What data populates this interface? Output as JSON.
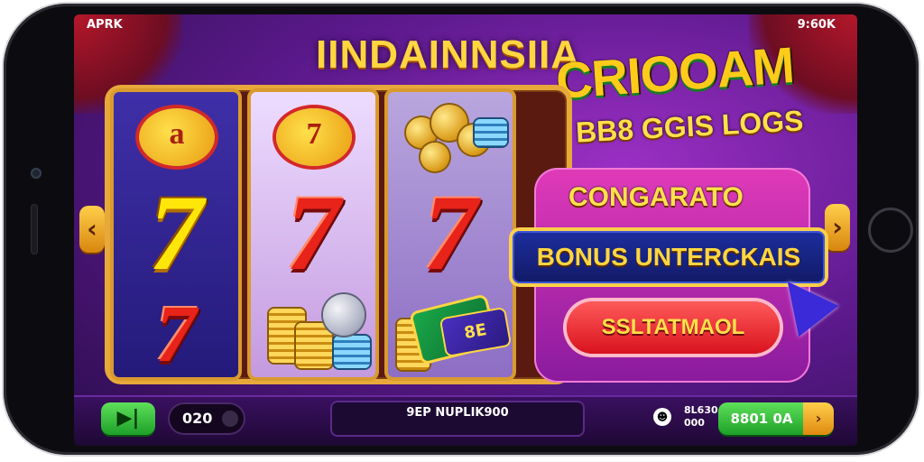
{
  "status_bar": {
    "left_text": "APRK",
    "right_text": "9:60K"
  },
  "header": {
    "title": "IINDAINNSIIA"
  },
  "brand": {
    "line1": "CRIOOAM",
    "line2": "BB8 GGIS LOGS"
  },
  "reels": {
    "reel1": {
      "top_symbol": "a",
      "middle": "7",
      "bottom": "7"
    },
    "reel2": {
      "top_symbol": "7",
      "middle": "7"
    },
    "reel3": {
      "middle": "7",
      "bill_label": "8E"
    }
  },
  "popup": {
    "congrats": "CONGARATO",
    "bonus": "BONUS UNTERCKAIS",
    "claim_button": "SSLTATMAOL"
  },
  "bottom_bar": {
    "play_button": "▶|",
    "bet_value": "020",
    "info_line1": "9EP NUPLIK900",
    "info_line2": "",
    "balance_line1": "8L630",
    "balance_line2": "000",
    "spin_button": "8801 0A",
    "spin_arrow": "›"
  },
  "icons": [
    "left-arrow-icon",
    "right-arrow-icon",
    "cursor-pointer-icon",
    "coin-icon",
    "bill-icon",
    "volume-icon"
  ]
}
